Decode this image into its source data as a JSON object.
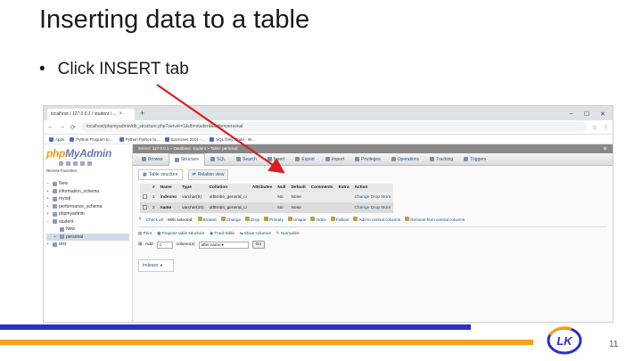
{
  "slide": {
    "title": "Inserting data to a table",
    "bullet_dot": "•",
    "bullet": "Click INSERT tab",
    "page_number": "11",
    "logo_text": "LK"
  },
  "colors": {
    "bar_blue": "#2b2ecc",
    "bar_orange": "#f4a01d",
    "arrow": "#d62020",
    "pma_blue": "#235a81"
  },
  "browser": {
    "tab_title": "localhost / 127.0.0.1 / student / ...",
    "tab_close": "×",
    "new_tab": "+",
    "url": "localhost/phpmyadmin/db_structure.php?server=1&db=student&table=personal",
    "bookmarks": [
      "Apps",
      "Python Program to ...",
      "Python Python fo...",
      "Exercises 2014 -...",
      "SQL Only Mode - W..."
    ]
  },
  "left_panel": {
    "logo_php": "php",
    "logo_my": "MyAdmin",
    "recent": "Recent  Favorites",
    "tree": [
      {
        "label": "New",
        "indent": 0
      },
      {
        "label": "information_schema",
        "indent": 0
      },
      {
        "label": "mysql",
        "indent": 0
      },
      {
        "label": "performance_schema",
        "indent": 0
      },
      {
        "label": "phpmyadmin",
        "indent": 0
      },
      {
        "label": "student",
        "indent": 0
      },
      {
        "label": "New",
        "indent": 1
      },
      {
        "label": "personal",
        "indent": 1
      },
      {
        "label": "test",
        "indent": 0
      }
    ]
  },
  "main": {
    "breadcrumb": "Server: 127.0.0.1 » Database: student » Table: personal",
    "menu_tabs": [
      "Browse",
      "Structure",
      "SQL",
      "Search",
      "Insert",
      "Export",
      "Import",
      "Privileges",
      "Operations",
      "Tracking",
      "Triggers"
    ],
    "active_tab": "Structure",
    "subtabs": [
      "Table structure",
      "Relation view"
    ],
    "columns_header": [
      "#",
      "Name",
      "Type",
      "Collation",
      "Attributes",
      "Null",
      "Default",
      "Comments",
      "Extra",
      "Action"
    ],
    "rows": [
      {
        "num": "1",
        "name": "indexno",
        "type": "varchar(5)",
        "collation": "utf8mb4_general_ci",
        "null": "No",
        "default": "None",
        "change": "Change",
        "drop": "Drop",
        "more": "More"
      },
      {
        "num": "2",
        "name": "name",
        "type": "varchar(10)",
        "collation": "utf8mb4_general_ci",
        "null": "No",
        "default": "None",
        "change": "Change",
        "drop": "Drop",
        "more": "More"
      }
    ],
    "with_selected": [
      "Check all",
      "With selected:",
      "Browse",
      "Change",
      "Drop",
      "Primary",
      "Unique",
      "Index",
      "Fulltext",
      "Add to central columns",
      "Remove from central columns"
    ],
    "tools": [
      "Print",
      "Propose table structure",
      "Track table",
      "Move columns",
      "Normalize"
    ],
    "add": {
      "label": "Add",
      "value": "1",
      "unit": "column(s)",
      "position": "after name",
      "go": "Go"
    },
    "indexes": "Indexes"
  }
}
